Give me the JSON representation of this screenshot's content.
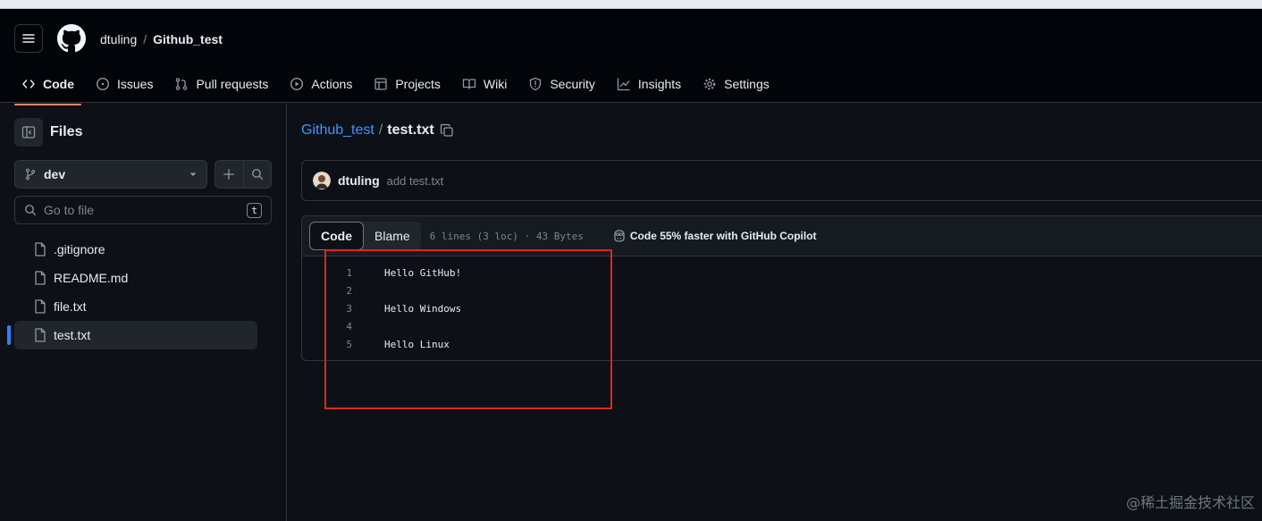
{
  "header": {
    "owner": "dtuling",
    "separator": "/",
    "repo": "Github_test"
  },
  "nav": {
    "code": "Code",
    "issues": "Issues",
    "pull_requests": "Pull requests",
    "actions": "Actions",
    "projects": "Projects",
    "wiki": "Wiki",
    "security": "Security",
    "insights": "Insights",
    "settings": "Settings"
  },
  "sidebar": {
    "title": "Files",
    "branch": "dev",
    "goto_placeholder": "Go to file",
    "goto_shortcut": "t",
    "files": [
      ".gitignore",
      "README.md",
      "file.txt",
      "test.txt"
    ]
  },
  "path": {
    "repo": "Github_test",
    "separator": "/",
    "file": "test.txt"
  },
  "commit": {
    "author": "dtuling",
    "message": "add test.txt"
  },
  "file_view": {
    "tab_code": "Code",
    "tab_blame": "Blame",
    "meta": "6 lines (3 loc) · 43 Bytes",
    "copilot": "Code 55% faster with GitHub Copilot",
    "lines": [
      {
        "n": "1",
        "text": "Hello GitHub!"
      },
      {
        "n": "2",
        "text": ""
      },
      {
        "n": "3",
        "text": "Hello Windows"
      },
      {
        "n": "4",
        "text": ""
      },
      {
        "n": "5",
        "text": "Hello Linux"
      }
    ]
  },
  "watermark": "@稀土掘金技术社区",
  "colors": {
    "background": "#0d1117",
    "accent_link": "#4493f8",
    "active_tab_underline": "#f78166",
    "annotation_box": "#e0261c"
  }
}
